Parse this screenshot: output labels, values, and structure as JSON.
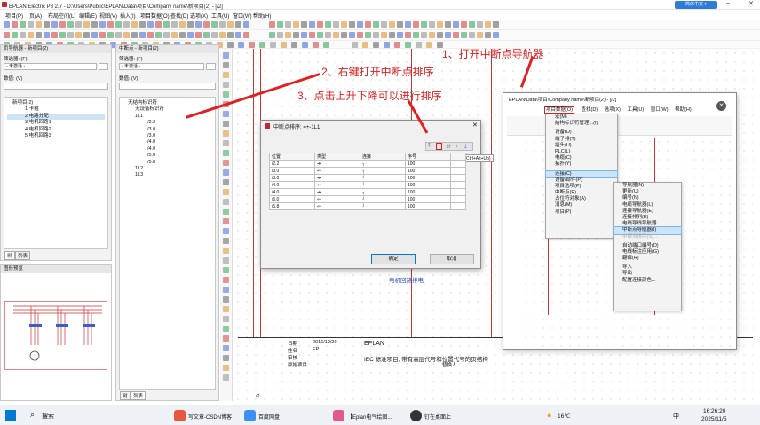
{
  "window": {
    "title": "EPLAN Electric P8 2.7 - D:\\Users\\Public\\EPLAN\\Data\\项目\\Company name\\新项目(2) - [/2]",
    "lang": "简体中文 ▾"
  },
  "menu": [
    "项目(P)",
    "页(A)",
    "布局空间(L)",
    "编辑(E)",
    "视图(V)",
    "插入(I)",
    "项目数据(O)",
    "查找(D)",
    "选项(X)",
    "工具(U)",
    "窗口(W)",
    "帮助(H)"
  ],
  "left_panel": {
    "title": "页导航器 - 新项目(2)",
    "filter_label": "筛选器: (F)",
    "filter_value": "- 未激活 -",
    "value_label": "数值: (V)",
    "tree": [
      "新项目(2)",
      "1 卡箍",
      "2 电路分配",
      "3 电机回路1",
      "4 电机回路2",
      "5 电机回路3"
    ],
    "tab_tree": "树",
    "tab_list": "列表"
  },
  "preview": {
    "title": "图形预览"
  },
  "mid_panel": {
    "title": "中断点 - 新项目(2)",
    "filter_label": "筛选器: (F)",
    "filter_value": "- 未激活 -",
    "value_label": "数值: (V)",
    "tree": [
      "无结构标识符",
      "无设备标识符",
      "1L1",
      "/2.2",
      "/3.0",
      "/3.0",
      "/4.0",
      "/4.0",
      "/5.0",
      "/5.8",
      "1L2",
      "1L3"
    ],
    "tab_tree": "树",
    "tab_list": "列表"
  },
  "annotations": {
    "a1": "1、打开中断点导航器",
    "a2": "2、右键打开中断点排序",
    "a3": "3、点击上升下降可以进行排序"
  },
  "dialog": {
    "title": "中断点排序: =+-1L1",
    "tooltip": "向上移动 (Ctrl+Alt+Up)",
    "headers": [
      "位置",
      "类型",
      "连接",
      "序号"
    ],
    "rows": [
      [
        "/2.2",
        "100"
      ],
      [
        "/3.0",
        "100"
      ],
      [
        "/3.0",
        "100"
      ],
      [
        "/4.0",
        "100"
      ],
      [
        "/4.0",
        "100"
      ],
      [
        "/5.0",
        "100"
      ],
      [
        "/5.8",
        "100"
      ]
    ],
    "ok": "确定",
    "cancel": "取消"
  },
  "inner_window": {
    "title": "EPLAN\\Data\\项目\\Company name\\新项目(2) - [/2]",
    "menu": [
      "项目数据(O)",
      "查找(D)",
      "选项(X)",
      "工具(U)",
      "窗口(W)",
      "帮助(H)"
    ]
  },
  "ctx_menu": [
    "宏(M)",
    "结构标识符管理...(I)",
    "设备(D)",
    "端子排(T)",
    "插头(U)",
    "PLC(L)",
    "电缆(C)",
    "拓扑(Y)",
    "连接(C)",
    "设备/部件(P)",
    "项目选项(P)",
    "中断点(R)",
    "占位符对象(A)",
    "消息(M)",
    "项目(P)"
  ],
  "sub_menu": [
    "导航器(N)",
    "更新(U)",
    "编号(N)",
    "电缆导航器(L)",
    "连接导航器(E)",
    "连接排列(E)",
    "电线导线导航器",
    "中断点导航器(I)",
    "中断点排序(S)...",
    "自动端口编号(D)",
    "电线标注应用(G)",
    "翻译(R)",
    "导入",
    "导出",
    "配置连接颜色..."
  ],
  "drawing": {
    "label": "电机回路排电",
    "date_label": "日期",
    "date": "2016/12/20",
    "name_label": "姓名",
    "name": "EP",
    "check_label": "审核",
    "company": "EPLAN",
    "desc": "IEC 标准项目, 带有高层代号和位置代号的页结构",
    "approve": "原始项目",
    "by": "替换人",
    "tab": "/2"
  },
  "taskbar": {
    "search": "搜索",
    "apps": [
      "写文章-CSDN博客",
      "百度网盘",
      "【Eplan电气绘图...",
      "钉在桌面上"
    ],
    "weather": "16℃",
    "lang": "中",
    "time": "16:26:20",
    "date": "2025/11/5"
  }
}
